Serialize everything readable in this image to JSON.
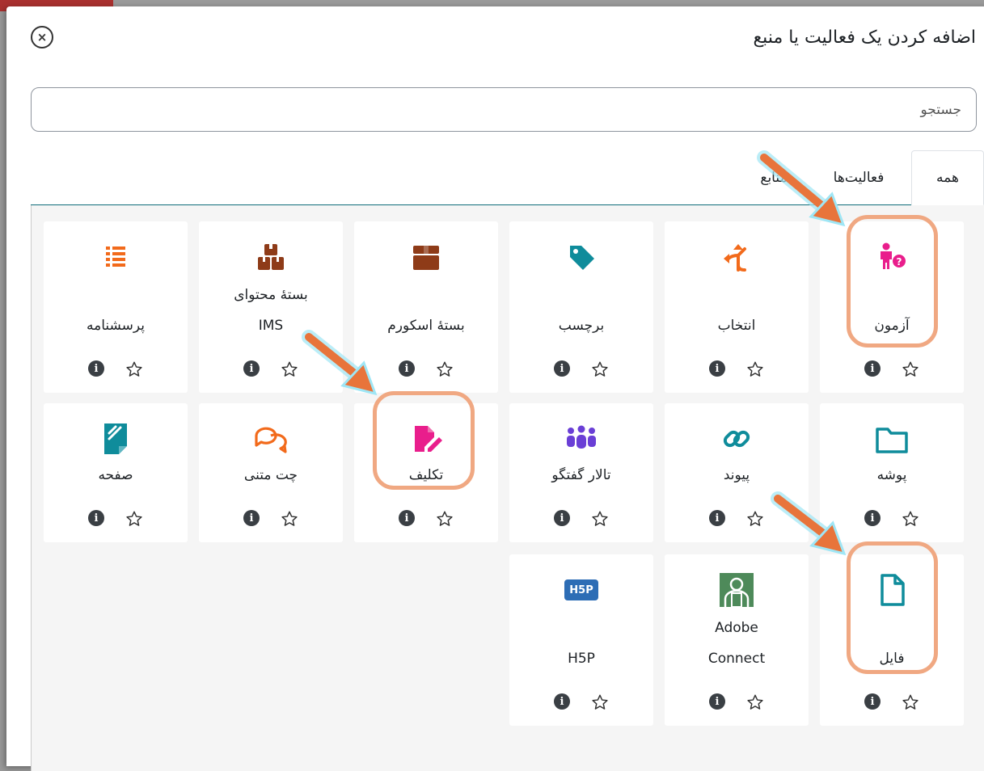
{
  "dialog": {
    "title": "اضافه کردن یک فعالیت یا منبع",
    "close_label": "×"
  },
  "search": {
    "placeholder": "جستجو",
    "value": ""
  },
  "tabs": [
    {
      "label": "همه",
      "active": true
    },
    {
      "label": "فعالیت‌ها",
      "active": false
    },
    {
      "label": "منابع",
      "active": false
    }
  ],
  "cards": [
    {
      "label": "آزمون",
      "icon": "quiz-icon",
      "color": "#e91e8c"
    },
    {
      "label": "انتخاب",
      "icon": "choice-icon",
      "color": "#f26a1b"
    },
    {
      "label": "برچسب",
      "icon": "label-icon",
      "color": "#0f8c9b"
    },
    {
      "label": "بستهٔ اسکورم",
      "icon": "scorm-package-icon",
      "color": "#8e3b18"
    },
    {
      "label_line1": "بستهٔ محتوای",
      "label_line2": "IMS",
      "icon": "ims-package-icon",
      "color": "#8e3b18"
    },
    {
      "label": "پرسشنامه",
      "icon": "questionnaire-icon",
      "color": "#f26a1b"
    },
    {
      "label": "پوشه",
      "icon": "folder-icon",
      "color": "#0f8c9b"
    },
    {
      "label": "پیوند",
      "icon": "link-icon",
      "color": "#0f8c9b"
    },
    {
      "label": "تالار گفتگو",
      "icon": "forum-icon",
      "color": "#6a3fd6"
    },
    {
      "label": "تکلیف",
      "icon": "assignment-icon",
      "color": "#e91e8c"
    },
    {
      "label": "چت متنی",
      "icon": "chat-icon",
      "color": "#f26a1b"
    },
    {
      "label": "صفحه",
      "icon": "page-icon",
      "color": "#0f8c9b"
    },
    {
      "label": "فایل",
      "icon": "file-icon",
      "color": "#0f8c9b"
    },
    {
      "label_line1": "Adobe",
      "label_line2": "Connect",
      "icon": "adobe-connect-icon",
      "color": "#4e8a5a"
    },
    {
      "label": "H5P",
      "icon": "h5p-icon",
      "color": "#2d6db5",
      "badge": "H5P"
    }
  ],
  "info_label": "i"
}
